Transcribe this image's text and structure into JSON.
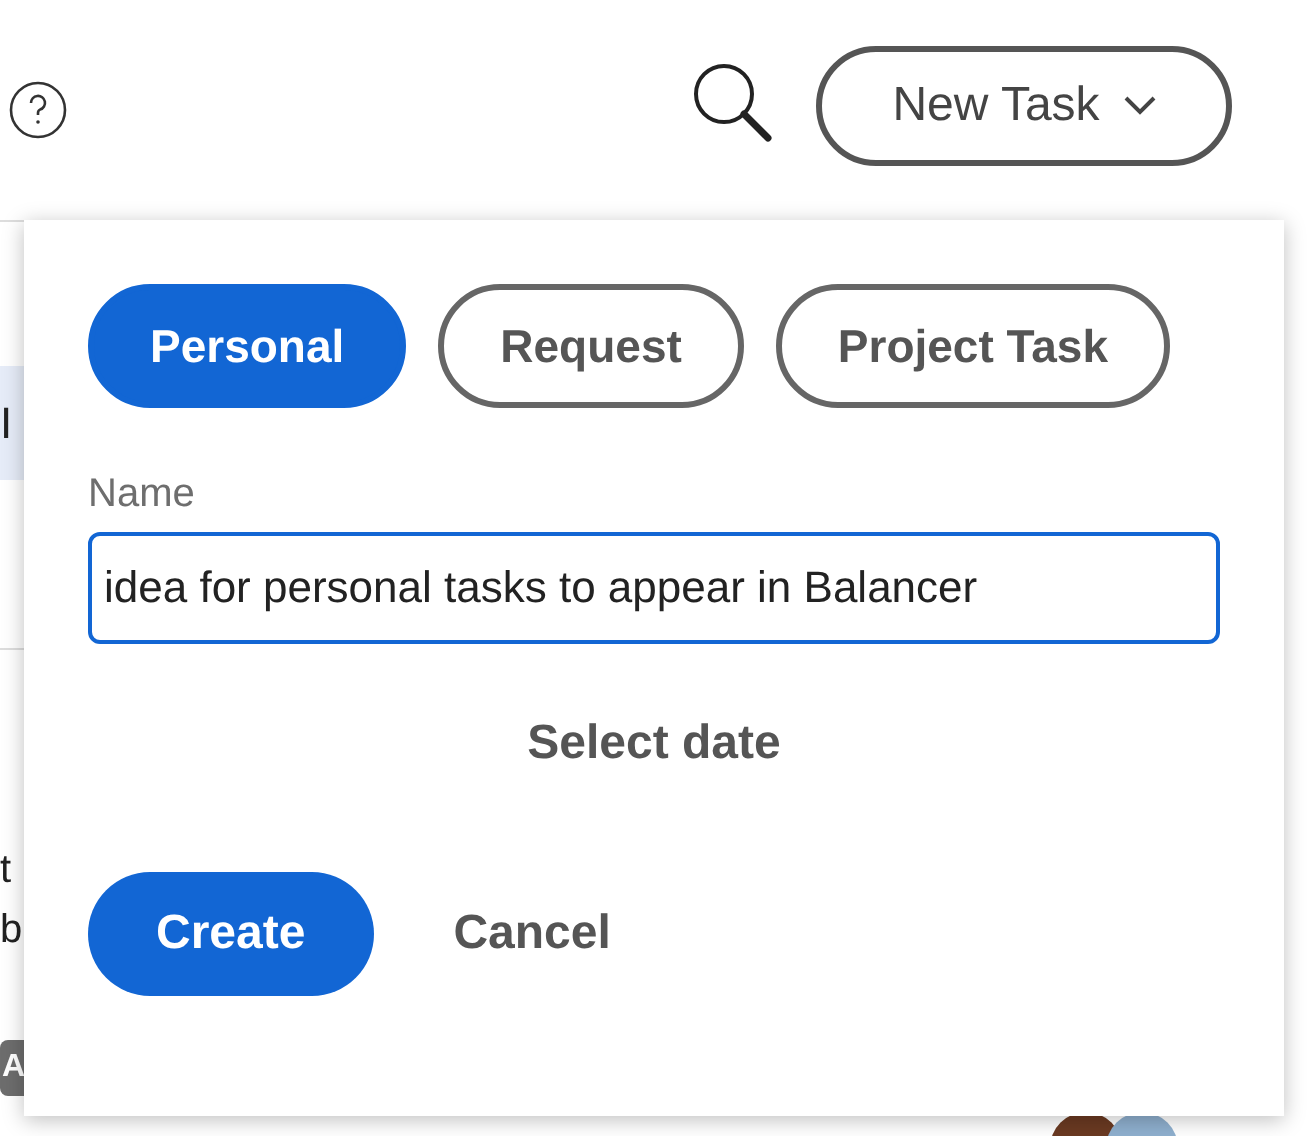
{
  "header": {
    "new_task_button": "New Task"
  },
  "background": {
    "rows": [
      "I",
      "t",
      "b"
    ],
    "badge": "A"
  },
  "popover": {
    "tabs": [
      {
        "label": "Personal",
        "selected": true
      },
      {
        "label": "Request",
        "selected": false
      },
      {
        "label": "Project Task",
        "selected": false
      }
    ],
    "name_label": "Name",
    "name_value": "idea for personal tasks to appear in Balancer",
    "date_button": "Select date",
    "buttons": [
      {
        "label": "Create",
        "kind": "primary"
      },
      {
        "label": "Cancel",
        "kind": "secondary"
      }
    ]
  }
}
